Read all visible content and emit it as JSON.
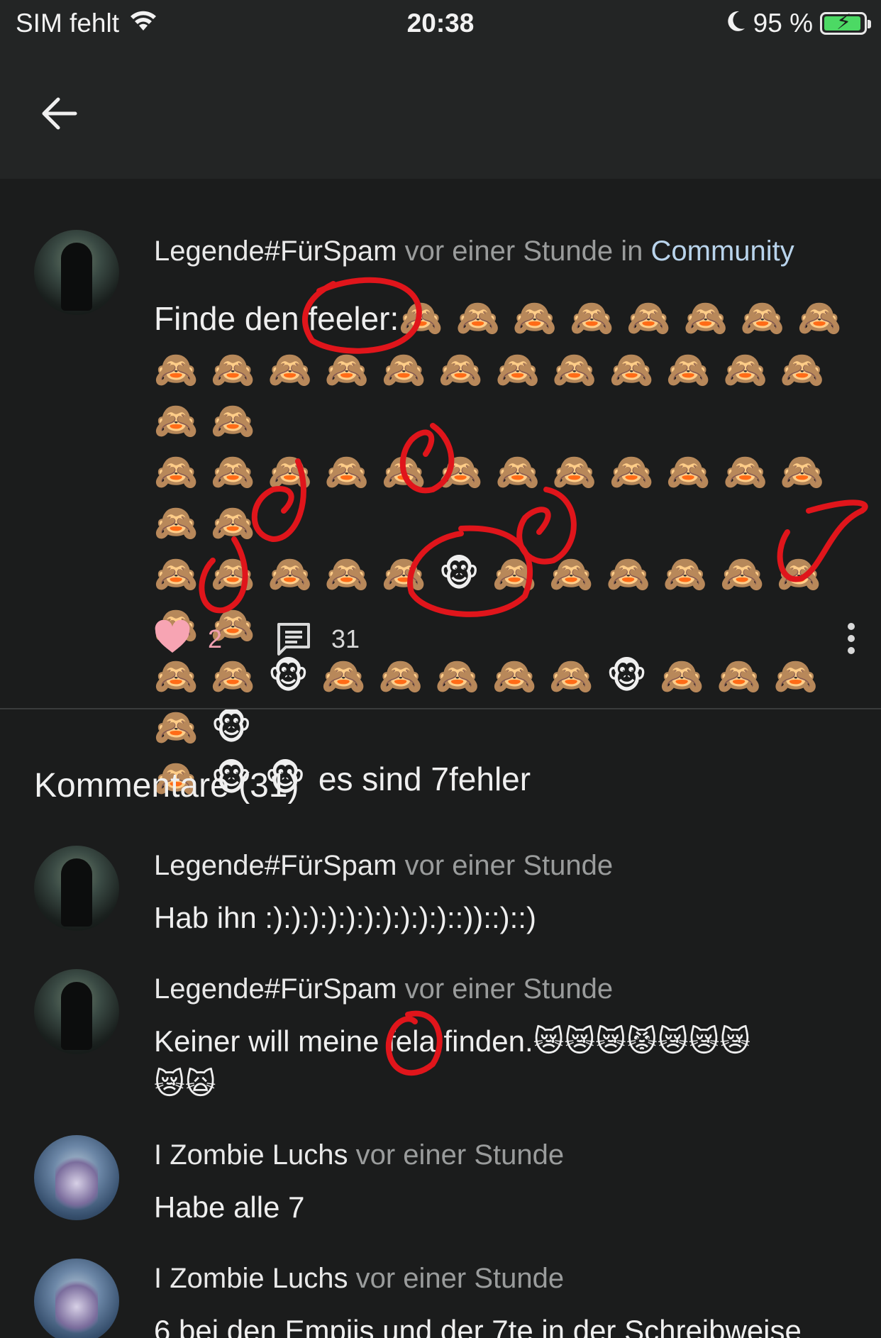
{
  "status_bar": {
    "carrier": "SIM fehlt",
    "time": "20:38",
    "battery_percent": "95 %",
    "battery_level": 0.95
  },
  "post": {
    "author": "Legende#FürSpam",
    "time": "vor einer Stunde",
    "in_label": "in",
    "community": "Community",
    "text_prefix": "Finde den feeler:",
    "row1": "🙈🙈🙈🙈🙈🙈🙈🙈",
    "row2": "🙈🙈🙈🙈🙈🙈🙈🙈🙈🙈🙈🙈🙈🙈",
    "row3": "🙈🙈🙈🙈🙈🙈🙈🙈🙈🙈🙈🙈🙈🙈",
    "row4": "🙈🙈🙈🙈🙈🐵🙈🙈🙈🙈🙈🙈🙈🙈",
    "row5": "🙈🙈🐵🙈🙈🙈🙈🙈🐵🙈🙈🙈🙈🐵",
    "row6_emoji": "🙈🐵🐵",
    "text_suffix": "es sind 7fehler",
    "likes": "2",
    "comments": "31"
  },
  "comments_heading": "Kommentare (31)",
  "comments": [
    {
      "author": "Legende#FürSpam",
      "time": "vor einer Stunde",
      "text": "Hab ihn :):):):):):):):):):)::))::)::)"
    },
    {
      "author": "Legende#FürSpam",
      "time": "vor einer Stunde",
      "text": "Keiner will meine fela finden.😿😿😿😾😿😿😿",
      "text2": "😿🙀"
    },
    {
      "author": "I Zombie Luchs",
      "time": "vor einer Stunde",
      "text": "Habe alle 7"
    },
    {
      "author": "I Zombie Luchs",
      "time": "vor einer Stunde",
      "text": "6 bei den Empiis und der 7te in der Schreibweise"
    }
  ],
  "colors": {
    "background": "#1b1c1c",
    "bar": "#232525",
    "community_link": "#b9d4ec",
    "like": "#f7a4b3",
    "annotation_red": "#e0151b"
  }
}
